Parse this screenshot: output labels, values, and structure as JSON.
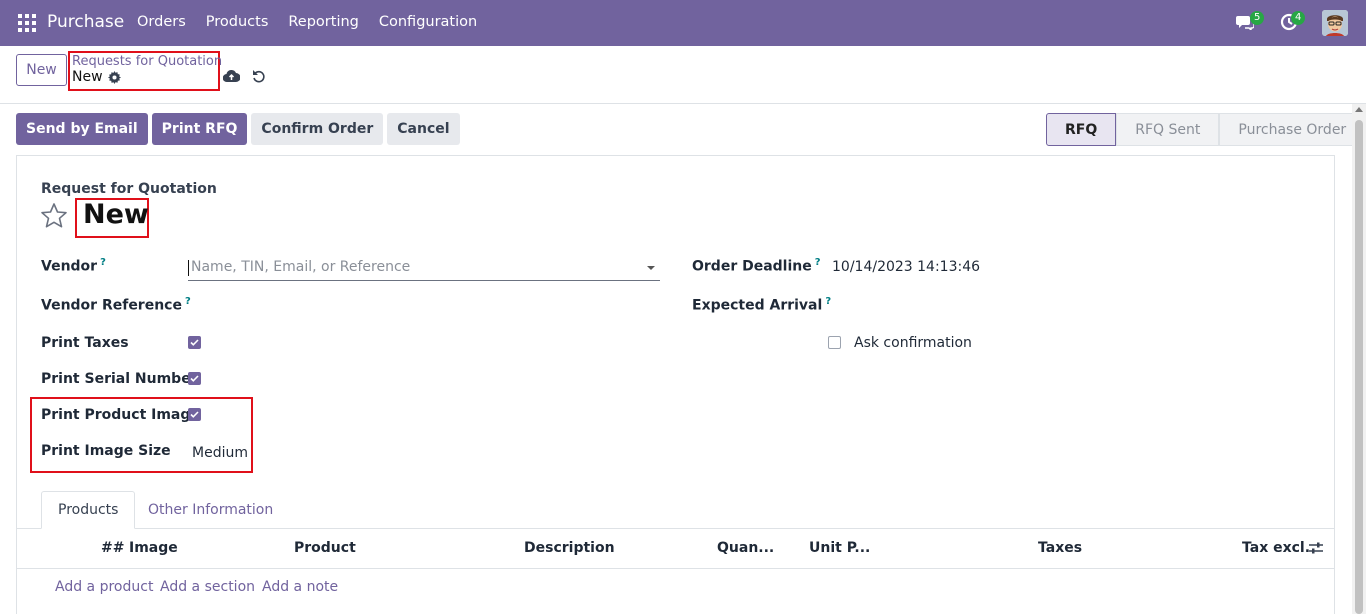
{
  "nav": {
    "app_name": "Purchase",
    "menu": [
      "Orders",
      "Products",
      "Reporting",
      "Configuration"
    ],
    "chat_badge": "5",
    "activity_badge": "4",
    "bar_color": "#71639e"
  },
  "control_panel": {
    "new_label": "New",
    "breadcrumb_parent": "Requests for Quotation",
    "breadcrumb_current": "New"
  },
  "actions": {
    "send_email": "Send by Email",
    "print_rfq": "Print RFQ",
    "confirm": "Confirm Order",
    "cancel": "Cancel"
  },
  "status": {
    "stages": [
      "RFQ",
      "RFQ Sent",
      "Purchase Order"
    ],
    "active": "RFQ"
  },
  "form": {
    "doc_type": "Request for Quotation",
    "title": "New",
    "vendor_label": "Vendor",
    "vendor_placeholder": "Name, TIN, Email, or Reference",
    "vendor_ref_label": "Vendor Reference",
    "print_taxes_label": "Print Taxes",
    "print_serial_label": "Print Serial Number",
    "print_image_label": "Print Product Image",
    "image_size_label": "Print Image Size",
    "image_size_value": "Medium",
    "deadline_label": "Order Deadline",
    "deadline_value": "10/14/2023 14:13:46",
    "arrival_label": "Expected Arrival",
    "ask_confirm_label": "Ask confirmation",
    "help_mark": "?",
    "print_taxes": true,
    "print_serial": true,
    "print_image": true,
    "ask_confirm": false
  },
  "tabs": {
    "products": "Products",
    "other": "Other Information"
  },
  "table": {
    "columns": [
      "##",
      "Image",
      "Product",
      "Description",
      "Quan...",
      "Unit P...",
      "Taxes",
      "Tax excl."
    ],
    "add_product": "Add a product",
    "add_section": "Add a section",
    "add_note": "Add a note"
  }
}
